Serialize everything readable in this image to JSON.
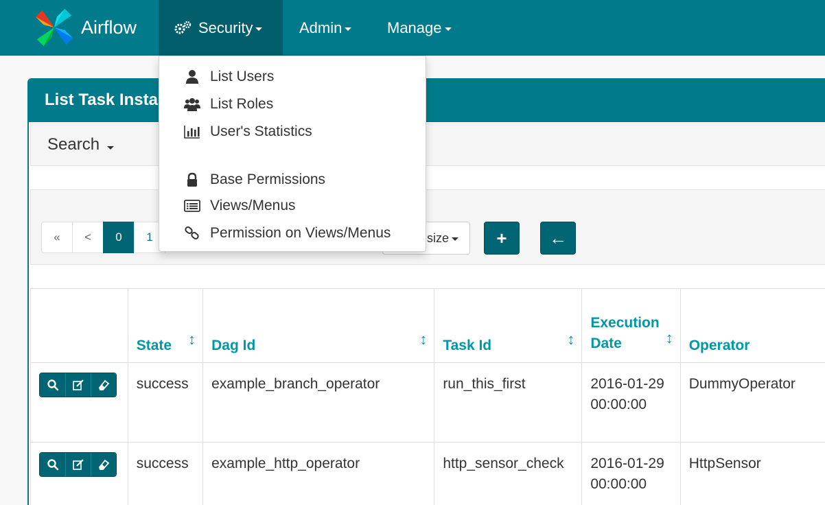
{
  "navbar": {
    "brand": "Airflow",
    "menus": [
      {
        "label": "Security",
        "active": true
      },
      {
        "label": "Admin",
        "active": false
      },
      {
        "label": "Manage",
        "active": false
      }
    ]
  },
  "security_menu": {
    "items": [
      {
        "label": "List Users",
        "icon": "user-icon"
      },
      {
        "label": "List Roles",
        "icon": "users-icon"
      },
      {
        "label": "User's Statistics",
        "icon": "bar-chart-icon"
      },
      {
        "label": "Base Permissions",
        "icon": "lock-icon"
      },
      {
        "label": "Views/Menus",
        "icon": "list-alt-icon"
      },
      {
        "label": "Permission on Views/Menus",
        "icon": "link-icon"
      }
    ]
  },
  "panel": {
    "title": "List Task Insta",
    "search_label": "Search"
  },
  "toolbar": {
    "pager": [
      "«",
      "<",
      "0",
      "1"
    ],
    "active_page": "0",
    "page_size_label": "size",
    "add_label": "+",
    "back_label": "←"
  },
  "table": {
    "columns": [
      {
        "label": "",
        "sortable": false
      },
      {
        "label": "State",
        "sortable": true
      },
      {
        "label": "Dag Id",
        "sortable": true
      },
      {
        "label": "Task Id",
        "sortable": true
      },
      {
        "label": "Execution Date",
        "sortable": true
      },
      {
        "label": "Operator",
        "sortable": false
      }
    ],
    "rows": [
      {
        "state": "success",
        "dag_id": "example_branch_operator",
        "task_id": "run_this_first",
        "execution_date": "2016-01-29 00:00:00",
        "operator": "DummyOperator"
      },
      {
        "state": "success",
        "dag_id": "example_http_operator",
        "task_id": "http_sensor_check",
        "execution_date": "2016-01-29 00:00:00",
        "operator": "HttpSensor"
      }
    ]
  },
  "colors": {
    "primary": "#017b8b",
    "primary_dark": "#016573",
    "link": "#0097a7"
  }
}
